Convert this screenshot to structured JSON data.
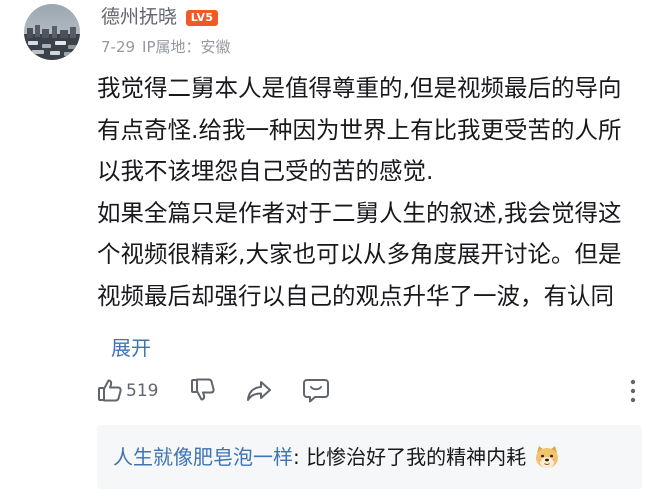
{
  "comment": {
    "author": {
      "name": "德州抚晓",
      "level_badge": "LV5",
      "avatar_icon": "avatar-image"
    },
    "meta": {
      "date": "7-29",
      "ip_location": "IP属地：安徽"
    },
    "content_lines": [
      "我觉得二舅本人是值得尊重的,但是视频最后的导向",
      "有点奇怪.给我一种因为世界上有比我更受苦的人所",
      "以我不该埋怨自己受的苦的感觉.",
      "如果全篇只是作者对于二舅人生的叙述,我会觉得这",
      "个视频很精彩,大家也可以从多角度展开讨论。但是",
      "视频最后却强行以自己的观点升华了一波，有认同"
    ],
    "expand_label": "展开",
    "actions": {
      "like_count": "519",
      "like_icon": "thumbs-up-icon",
      "dislike_icon": "thumbs-down-icon",
      "share_icon": "share-icon",
      "reply_icon": "reply-bubble-icon",
      "more_icon": "more-vertical-icon"
    }
  },
  "reply_preview": {
    "author": "人生就像肥皂泡一样",
    "separator": ": ",
    "text": "比惨治好了我的精神内耗",
    "emoji_icon": "doge-emoji"
  },
  "colors": {
    "link_blue": "#3e73b5",
    "level_badge_orange": "#f05a28",
    "meta_gray": "#9499a0",
    "username_gray": "#61666d",
    "reply_bg": "#f6f7f8"
  }
}
